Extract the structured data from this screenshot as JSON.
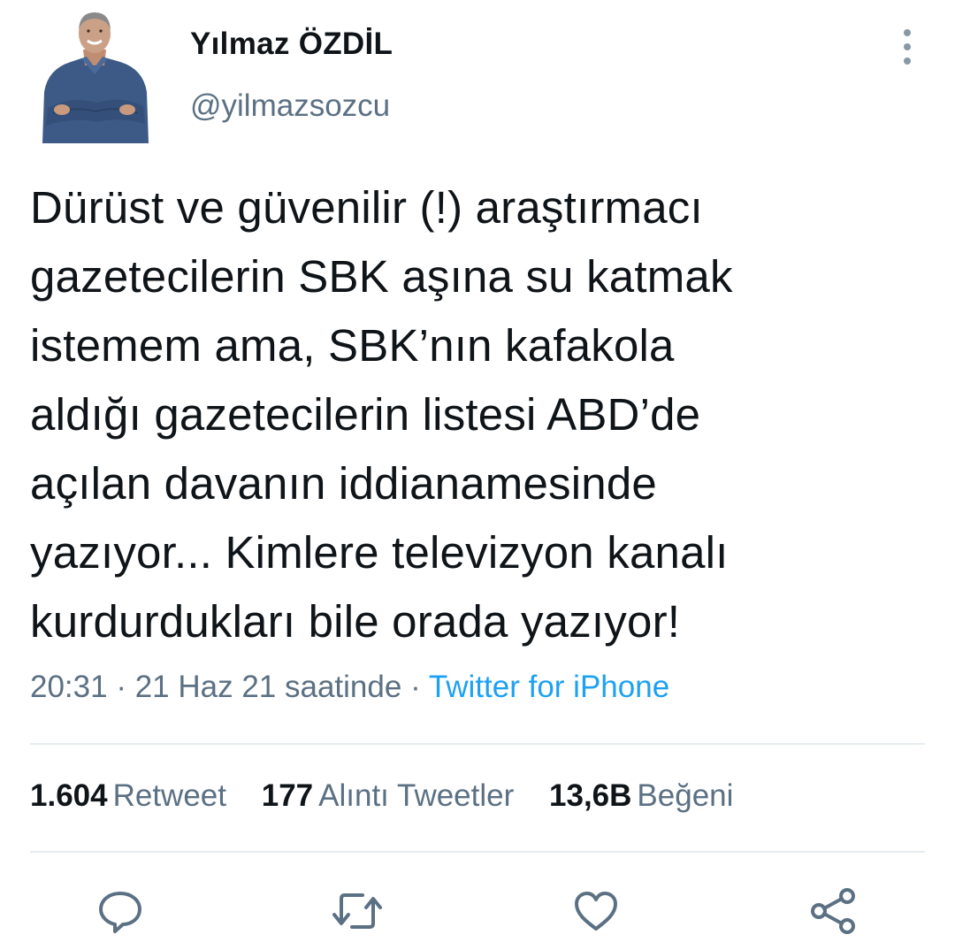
{
  "author": {
    "display_name": "Yılmaz ÖZDİL",
    "handle": "@yilmazsozcu",
    "avatar_icon": "profile-photo"
  },
  "tweet": {
    "lines": [
      "Dürüst ve güvenilir (!) araştırmacı",
      "gazetecilerin SBK aşına su katmak",
      "istemem ama, SBK’nın kafakola",
      "aldığı gazetecilerin listesi ABD’de",
      "açılan davanın iddianamesinde",
      "yazıyor... Kimlere televizyon kanalı",
      "kurdurdukları bile orada yazıyor!"
    ],
    "time": "20:31",
    "date": "21 Haz 21 saatinde",
    "separator": "·",
    "source": "Twitter for iPhone"
  },
  "stats": {
    "retweets": {
      "count": "1.604",
      "label": "Retweet"
    },
    "quotes": {
      "count": "177",
      "label": "Alıntı Tweetler"
    },
    "likes": {
      "count": "13,6B",
      "label": "Beğeni"
    }
  },
  "actions": {
    "reply_icon": "reply-icon",
    "retweet_icon": "retweet-icon",
    "like_icon": "heart-icon",
    "share_icon": "share-icon",
    "more_icon": "more-vertical-icon"
  },
  "colors": {
    "text": "#0f1419",
    "secondary": "#5b7083",
    "link": "#1da1f2",
    "divider": "#e6ecf0"
  }
}
